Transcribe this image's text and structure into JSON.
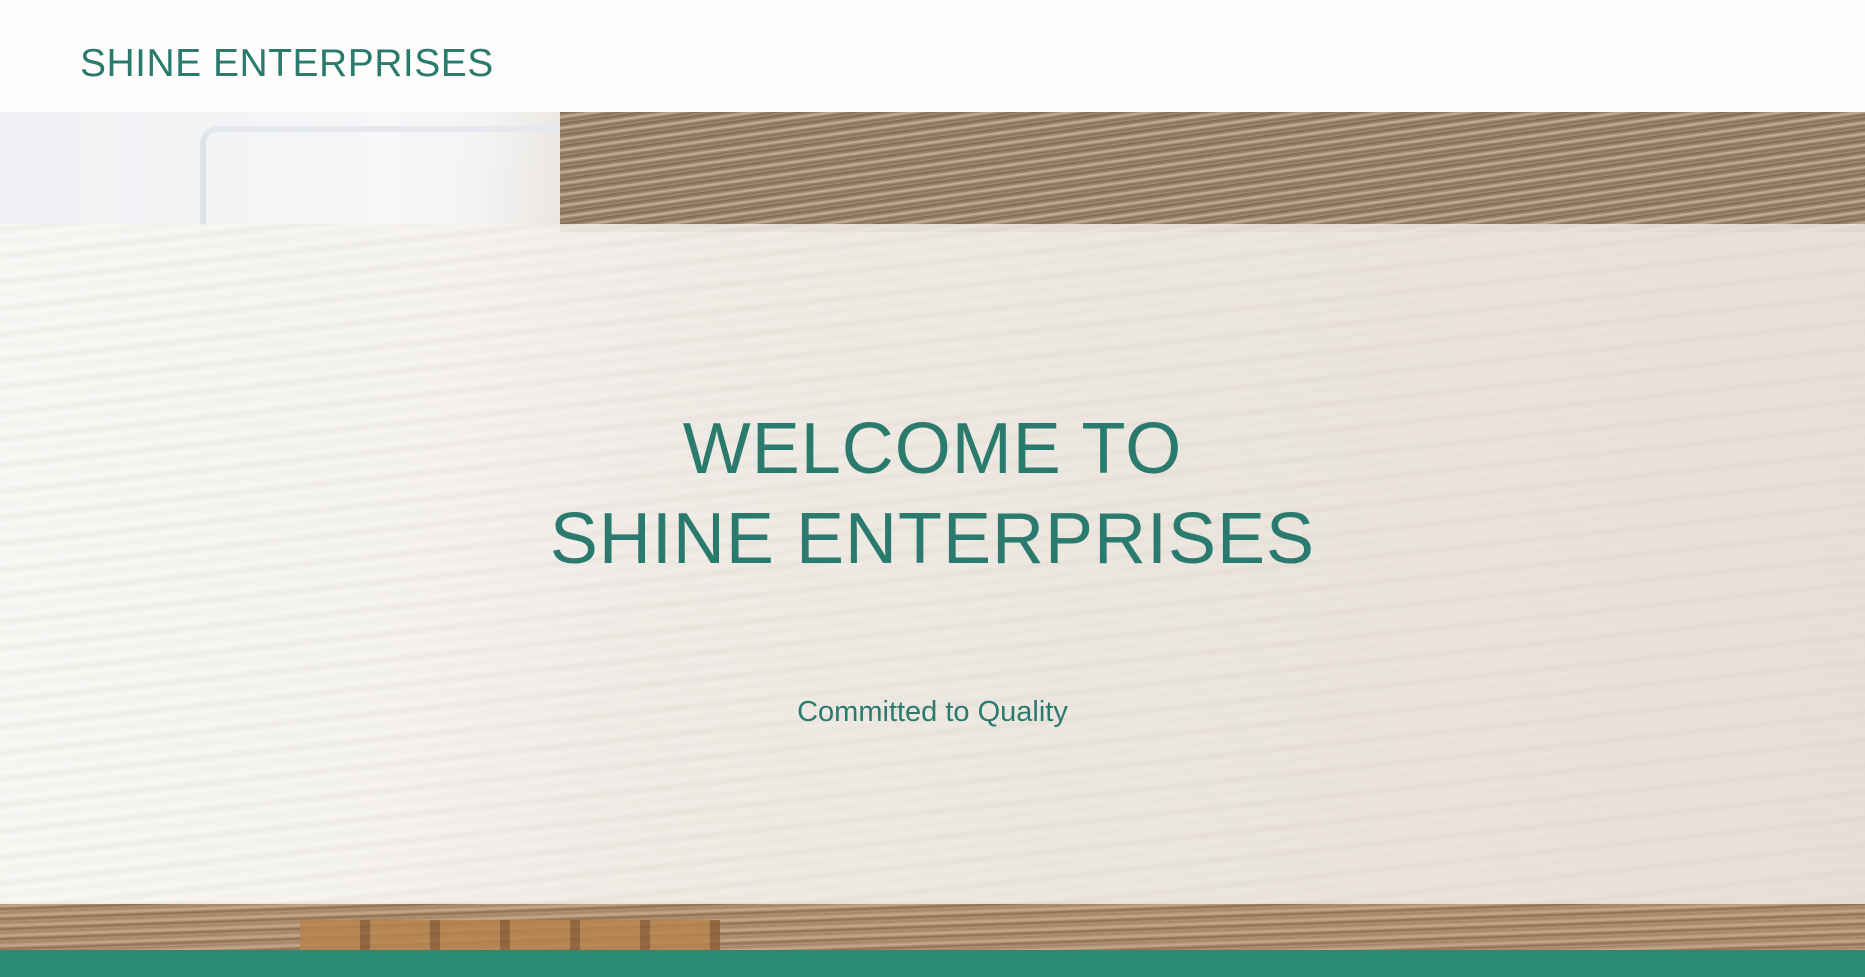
{
  "header": {
    "brand": "SHINE ENTERPRISES"
  },
  "hero": {
    "title_line1": "WELCOME TO",
    "title_line2": "SHINE ENTERPRISES",
    "tagline": "Committed to Quality",
    "background_image": "stack-of-paper-photo"
  },
  "colors": {
    "accent": "#2a7b6e",
    "footer_bar": "#2a8a75",
    "background": "#fffefc"
  }
}
